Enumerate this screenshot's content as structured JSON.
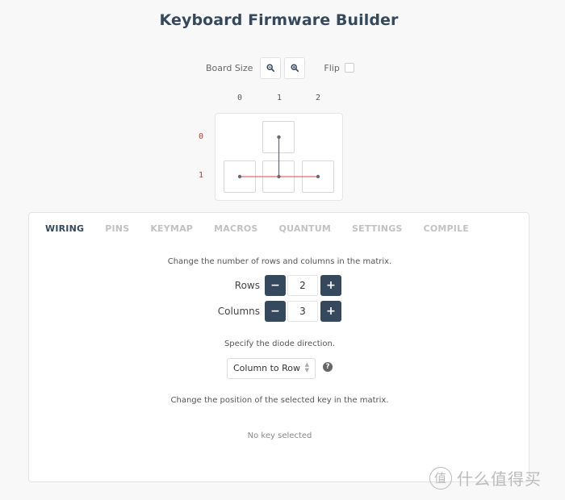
{
  "header": {
    "title": "Keyboard Firmware Builder"
  },
  "board_controls": {
    "board_size_label": "Board Size",
    "zoom_out_icon": "zoom-out-icon",
    "zoom_in_icon": "zoom-in-icon",
    "flip_label": "Flip",
    "flip_checked": false
  },
  "matrix": {
    "column_labels": [
      "0",
      "1",
      "2"
    ],
    "row_labels": [
      "0",
      "1"
    ],
    "keys": [
      {
        "row": 0,
        "col": 1
      },
      {
        "row": 1,
        "col": 0
      },
      {
        "row": 1,
        "col": 1
      },
      {
        "row": 1,
        "col": 2
      }
    ],
    "row_wire_color": "#e06c6c",
    "col_wire_color": "#6b6f80",
    "row_label_color": "#c0392b"
  },
  "tabs": [
    {
      "label": "WIRING",
      "active": true
    },
    {
      "label": "PINS",
      "active": false
    },
    {
      "label": "KEYMAP",
      "active": false
    },
    {
      "label": "MACROS",
      "active": false
    },
    {
      "label": "QUANTUM",
      "active": false
    },
    {
      "label": "SETTINGS",
      "active": false
    },
    {
      "label": "COMPILE",
      "active": false
    }
  ],
  "wiring": {
    "matrix_hint": "Change the number of rows and columns in the matrix.",
    "rows": {
      "label": "Rows",
      "value": "2",
      "minus": "−",
      "plus": "+"
    },
    "columns": {
      "label": "Columns",
      "value": "3",
      "minus": "−",
      "plus": "+"
    },
    "diode_hint": "Specify the diode direction.",
    "diode_direction": {
      "selected": "Column to Row",
      "arrows": "▲▼",
      "help_icon": "?"
    },
    "position_hint": "Change the position of the selected key in the matrix.",
    "no_key_text": "No key selected"
  },
  "colors": {
    "accent": "#34495e",
    "background": "#f8f8f8",
    "inactive_tab": "#c2c2c2"
  },
  "watermark": {
    "badge": "值",
    "text": "什么值得买"
  }
}
